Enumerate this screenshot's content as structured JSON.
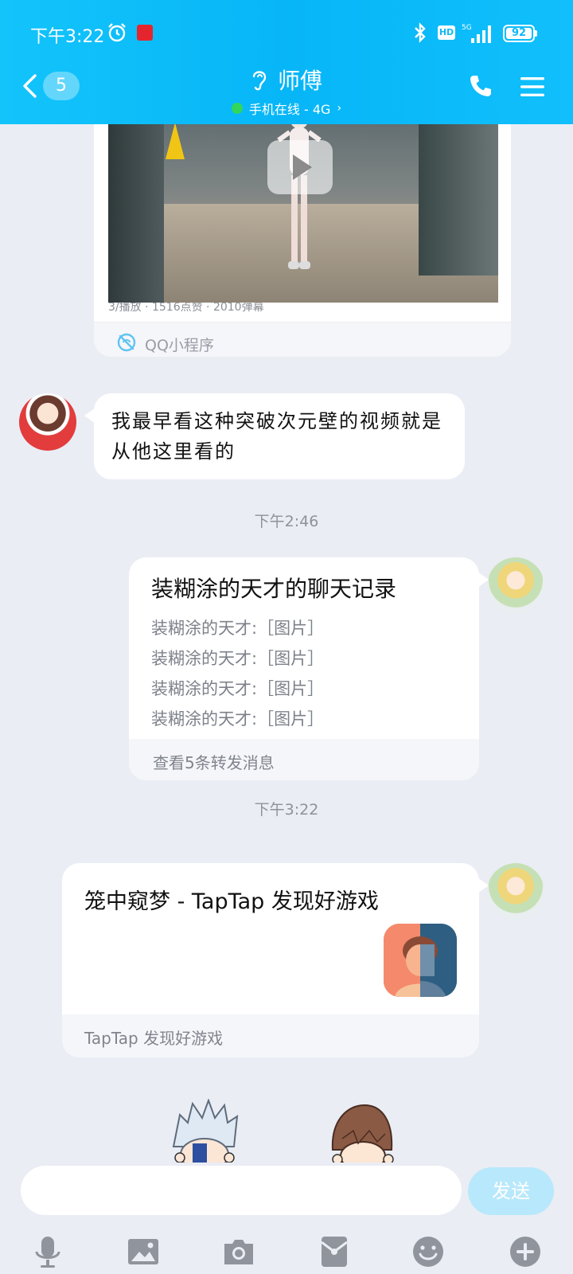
{
  "status_bar": {
    "time": "下午3:22",
    "hd": "HD",
    "network": "5G",
    "battery": "92"
  },
  "header": {
    "unread_count": "5",
    "contact_name": "师傅",
    "status_text": "手机在线 - 4G",
    "status_chevron": "›"
  },
  "messages": {
    "mini_program": {
      "caption": "3/播放 · 1516点赞 · 2010弹幕",
      "label": "QQ小程序"
    },
    "incoming_text": "我最早看这种突破次元壁的视频就是从他这里看的",
    "timestamp_1": "下午2:46",
    "chat_record": {
      "title": "装糊涂的天才的聊天记录",
      "lines": [
        "装糊涂的天才:［图片］",
        "装糊涂的天才:［图片］",
        "装糊涂的天才:［图片］",
        "装糊涂的天才:［图片］"
      ],
      "footer": "查看5条转发消息"
    },
    "timestamp_2": "下午3:22",
    "share_card": {
      "title": "笼中窥梦 - TapTap 发现好游戏",
      "source": "TapTap 发现好游戏"
    }
  },
  "input": {
    "value": "",
    "placeholder": "",
    "send_label": "发送"
  },
  "icons": {
    "back": "chevron-left-icon",
    "voice": "microphone-icon",
    "image": "image-icon",
    "camera": "camera-icon",
    "red_packet": "red-packet-icon",
    "emoji": "emoji-icon",
    "more": "plus-icon"
  },
  "colors": {
    "header": "#09b9f8",
    "background": "#eaedf4",
    "online": "#31d65b",
    "send_button": "#b8e8fb"
  }
}
